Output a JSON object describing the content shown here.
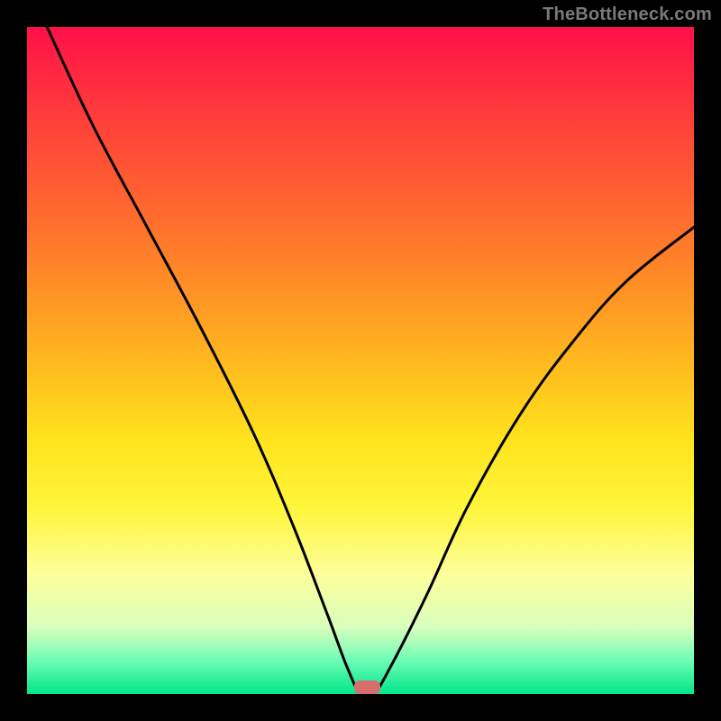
{
  "watermark": "TheBottleneck.com",
  "colors": {
    "background": "#000000",
    "gradient_top": "#ff1048",
    "gradient_bottom": "#00e689",
    "curve": "#000000",
    "marker": "#d76e6e",
    "watermark": "#7a7a7a"
  },
  "chart_data": {
    "type": "line",
    "title": "",
    "xlabel": "",
    "ylabel": "",
    "xlim": [
      0,
      100
    ],
    "ylim": [
      0,
      100
    ],
    "grid": false,
    "legend": false,
    "series": [
      {
        "name": "bottleneck-curve",
        "x": [
          3,
          10,
          18,
          26,
          34,
          40,
          45,
          48,
          50,
          52,
          55,
          60,
          66,
          74,
          82,
          90,
          100
        ],
        "values": [
          100,
          85,
          70,
          55,
          39,
          25,
          12,
          4,
          0,
          0,
          5,
          15,
          28,
          42,
          53,
          62,
          70
        ]
      }
    ],
    "marker": {
      "x": 51,
      "y": 0,
      "width": 4,
      "height": 2
    },
    "annotations": []
  }
}
